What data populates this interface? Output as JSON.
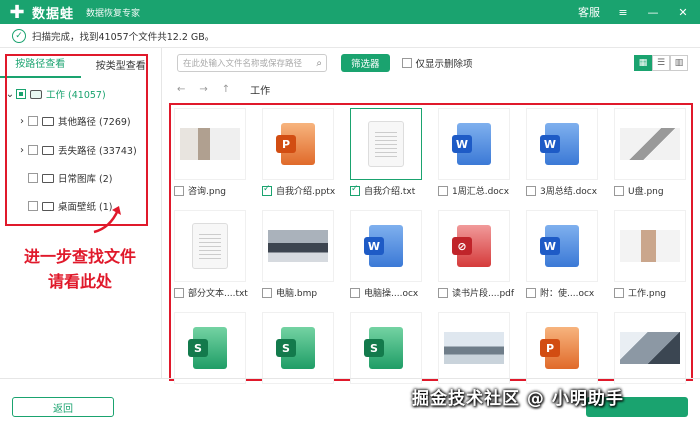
{
  "titlebar": {
    "brand": "数据蛙",
    "tagline": "数据恢复专家",
    "support": "客服",
    "btn_menu": "≡",
    "btn_min": "—",
    "btn_close": "✕"
  },
  "status": {
    "text": "扫描完成，找到41057个文件共12.2 GB。"
  },
  "sidebar": {
    "tab_path": "按路径查看",
    "tab_type": "按类型查看",
    "items": [
      {
        "label": "工作 (41057)"
      },
      {
        "label": "其他路径 (7269)"
      },
      {
        "label": "丢失路径 (33743)"
      },
      {
        "label": "日常图库 (2)"
      },
      {
        "label": "桌面壁纸 (1)"
      }
    ]
  },
  "annotation": {
    "line1": "进一步查找文件",
    "line2": "请看此处"
  },
  "toolbar": {
    "search_placeholder": "在此处输入文件名称或保存路径",
    "filter_label": "筛选器",
    "deleted_only_label": "仅显示删除项"
  },
  "nav": {
    "back": "←",
    "forward": "→",
    "up": "↑",
    "breadcrumb": "工作"
  },
  "files": [
    {
      "name": "咨询.png",
      "kind": "photo"
    },
    {
      "name": "自我介绍.pptx",
      "kind": "ppt"
    },
    {
      "name": "自我介绍.txt",
      "kind": "txt"
    },
    {
      "name": "1周汇总.docx",
      "kind": "word"
    },
    {
      "name": "3周总结.docx",
      "kind": "word"
    },
    {
      "name": "U盘.png",
      "kind": "photo"
    },
    {
      "name": "部分文本....txt",
      "kind": "txt"
    },
    {
      "name": "电脑.bmp",
      "kind": "photo"
    },
    {
      "name": "电脑操....ocx",
      "kind": "word"
    },
    {
      "name": "读书片段....pdf",
      "kind": "pdf"
    },
    {
      "name": "附：使....ocx",
      "kind": "word"
    },
    {
      "name": "工作.png",
      "kind": "photo"
    },
    {
      "name": "",
      "kind": "xls"
    },
    {
      "name": "",
      "kind": "xls"
    },
    {
      "name": "",
      "kind": "xls"
    },
    {
      "name": "",
      "kind": "photo"
    },
    {
      "name": "",
      "kind": "ppt"
    },
    {
      "name": "",
      "kind": "photo"
    }
  ],
  "footer": {
    "back_label": "返回"
  },
  "watermark": "掘金技术社区 @ 小明助手",
  "colors": {
    "brand": "#1aa36f",
    "annotation": "#e0192b"
  }
}
